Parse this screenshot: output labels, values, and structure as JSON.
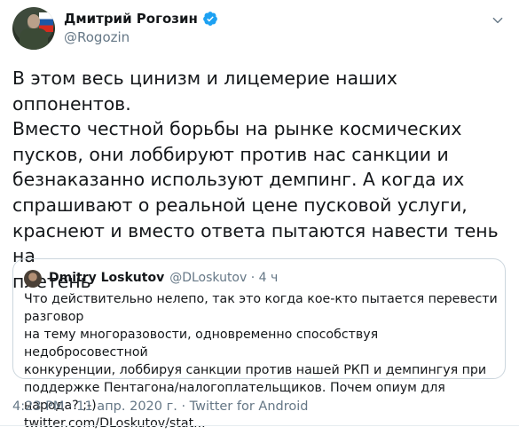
{
  "author": {
    "display_name": "Дмитрий Рогозин",
    "handle": "@Rogozin",
    "verified": true,
    "avatar_icon": "profile-photo",
    "verified_icon": "verified-badge-icon"
  },
  "tweet": {
    "text": "В этом весь цинизм и лицемерие наших оппонентов.\nВместо честной борьбы на рынке космических\nпусков, они лоббируют против нас санкции и\nбезнаказанно используют демпинг. А когда их\nспрашивают о реальной цене пусковой услуги,\nкраснеют и вместо ответа пытаются навести тень на\nплетень"
  },
  "quoted_tweet": {
    "name": "Dmitry Loskutov",
    "handle_time": "@DLoskutov · 4 ч",
    "text": "Что действительно нелепо, так это когда кое-кто пытается перевести разговор\nна тему многоразовости, одновременно способствуя недобросовестной\nконкуренции, лоббируя санкции против нашей РКП и демпингуя при\nподдержке Пентагона/налогоплательщиков.  Почем опиум для народа? ;-)\ntwitter.com/DLoskutov/stat..."
  },
  "meta": {
    "timestamp": "4:23 PM · 11 апр. 2020 г.",
    "separator": " · ",
    "source": "Twitter for Android"
  },
  "colors": {
    "verified_blue": "#1da1f2",
    "secondary_text": "#657786",
    "border": "#ccd6dd"
  }
}
